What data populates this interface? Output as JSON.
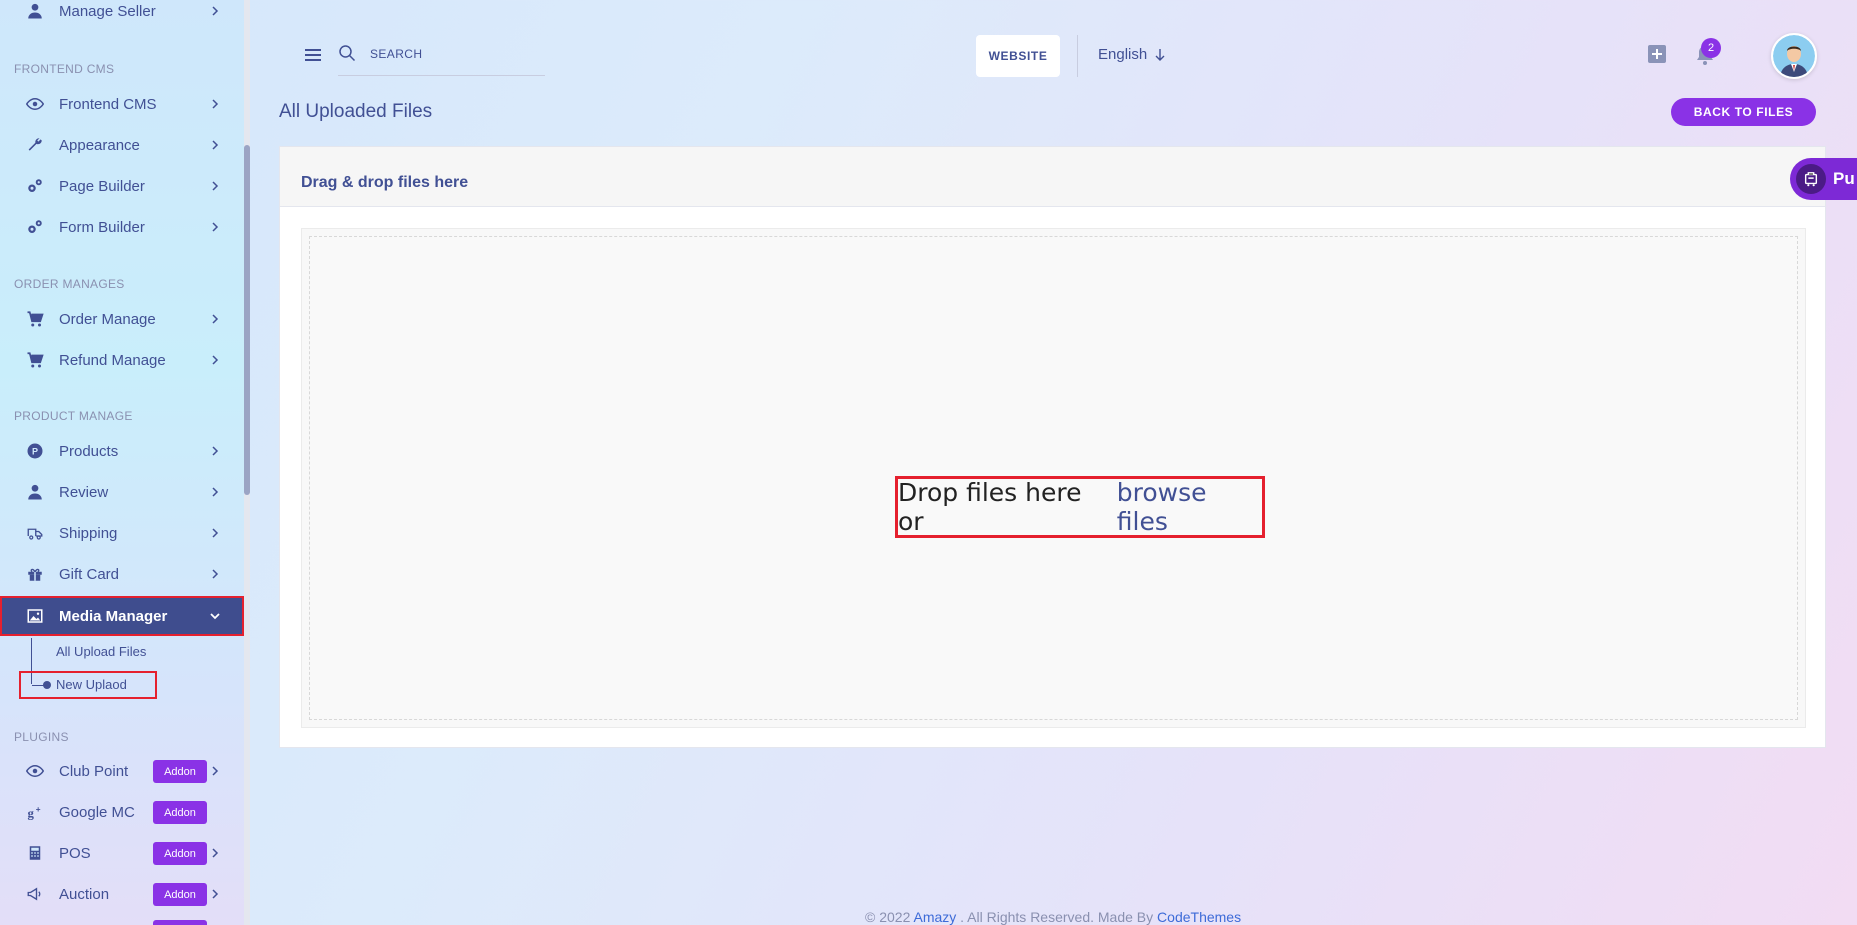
{
  "sidebar": {
    "top_item": {
      "label": "Manage Seller",
      "icon": "user-icon"
    },
    "sections": {
      "frontend_cms": "FRONTEND CMS",
      "order_manages": "ORDER MANAGES",
      "product_manage": "PRODUCT MANAGE",
      "plugins": "PLUGINS"
    },
    "frontend_items": [
      {
        "label": "Frontend CMS",
        "icon": "eye-icon"
      },
      {
        "label": "Appearance",
        "icon": "wrench-icon"
      },
      {
        "label": "Page Builder",
        "icon": "gears-icon"
      },
      {
        "label": "Form Builder",
        "icon": "gears-icon"
      }
    ],
    "order_items": [
      {
        "label": "Order Manage",
        "icon": "cart-icon"
      },
      {
        "label": "Refund Manage",
        "icon": "cart-icon"
      }
    ],
    "product_items": [
      {
        "label": "Products",
        "icon": "product-p-icon"
      },
      {
        "label": "Review",
        "icon": "user-icon"
      },
      {
        "label": "Shipping",
        "icon": "truck-icon"
      },
      {
        "label": "Gift Card",
        "icon": "gift-icon"
      }
    ],
    "media_manager": {
      "label": "Media Manager",
      "icon": "image-icon",
      "sub_items": [
        "All Upload Files",
        "New Uplaod"
      ]
    },
    "plugin_items": [
      {
        "label": "Club Point",
        "badge": "Addon",
        "icon": "eye-icon"
      },
      {
        "label": "Google MC",
        "badge": "Addon",
        "icon": "google-plus-icon"
      },
      {
        "label": "POS",
        "badge": "Addon",
        "icon": "calculator-icon"
      },
      {
        "label": "Auction",
        "badge": "Addon",
        "icon": "megaphone-icon"
      }
    ]
  },
  "header": {
    "search_placeholder": "SEARCH",
    "website_label": "WEBSITE",
    "language": "English",
    "notification_count": "2"
  },
  "page": {
    "title": "All Uploaded Files",
    "back_button": "BACK TO FILES",
    "card_title": "Drag & drop files here",
    "drop_text": "Drop files here or",
    "browse_text": "browse files",
    "floating_label": "Pu"
  },
  "footer": {
    "prefix": "© 2022",
    "brand": "Amazy",
    "middle": ". All Rights Reserved. Made By",
    "company": "CodeThemes"
  },
  "colors": {
    "primary": "#415094",
    "accent": "#8a32e6",
    "highlight_border": "#e5202e"
  }
}
